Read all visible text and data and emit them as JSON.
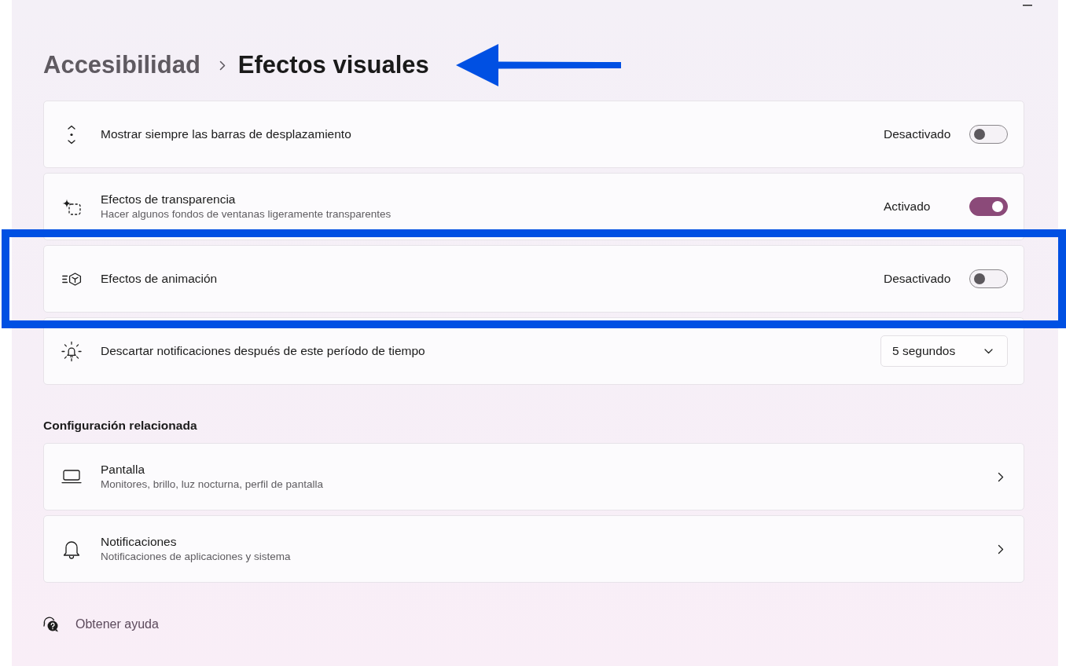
{
  "breadcrumb": {
    "items": [
      {
        "label": "Accesibilidad",
        "current": false
      },
      {
        "label": "Efectos visuales",
        "current": true
      }
    ],
    "arrow_annotation": true
  },
  "settings": [
    {
      "kind": "toggle",
      "title": "Mostrar siempre las barras de desplazamiento",
      "state_label": "Desactivado",
      "on": false,
      "highlighted": false
    },
    {
      "kind": "toggle",
      "title": "Efectos de transparencia",
      "description": "Hacer algunos fondos de ventanas ligeramente transparentes",
      "state_label": "Activado",
      "on": true,
      "highlighted": false
    },
    {
      "kind": "toggle",
      "title": "Efectos de animación",
      "state_label": "Desactivado",
      "on": false,
      "highlighted": true
    },
    {
      "kind": "dropdown",
      "title": "Descartar notificaciones después de este período de tiempo",
      "value": "5 segundos",
      "highlighted": false
    }
  ],
  "related_settings": {
    "heading": "Configuración relacionada",
    "items": [
      {
        "title": "Pantalla",
        "description": "Monitores, brillo, luz nocturna, perfil de pantalla"
      },
      {
        "title": "Notificaciones",
        "description": "Notificaciones de aplicaciones y sistema"
      }
    ]
  },
  "help_link": "Obtener ayuda"
}
